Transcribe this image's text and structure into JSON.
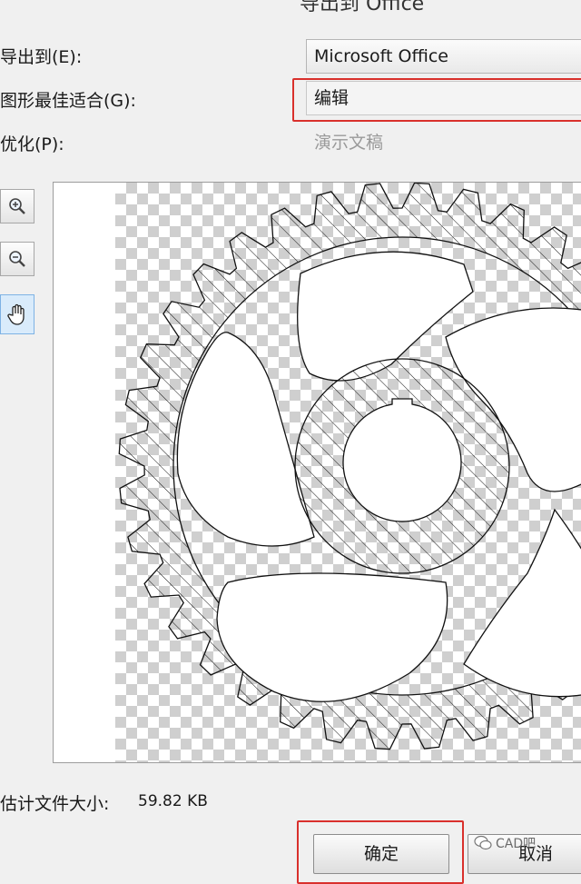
{
  "dialog": {
    "title": "导出到 Office"
  },
  "form": {
    "export_to_label": "导出到(E):",
    "export_to_value": "Microsoft Office",
    "fit_label": "图形最佳适合(G):",
    "fit_value": "编辑",
    "optimize_label": "优化(P):",
    "optimize_value": "演示文稿"
  },
  "tools": {
    "icons": [
      "zoom-in-icon",
      "zoom-out-icon",
      "hand-pan-icon"
    ],
    "active": "hand-pan-icon"
  },
  "footer": {
    "size_label": "估计文件大小:",
    "size_value": "59.82 KB",
    "ok_label": "确定",
    "cancel_label": "取消"
  },
  "watermark": {
    "text": "CAD吧"
  },
  "colors": {
    "highlight": "#d9302c",
    "active_tool": "#d9ebfb"
  }
}
